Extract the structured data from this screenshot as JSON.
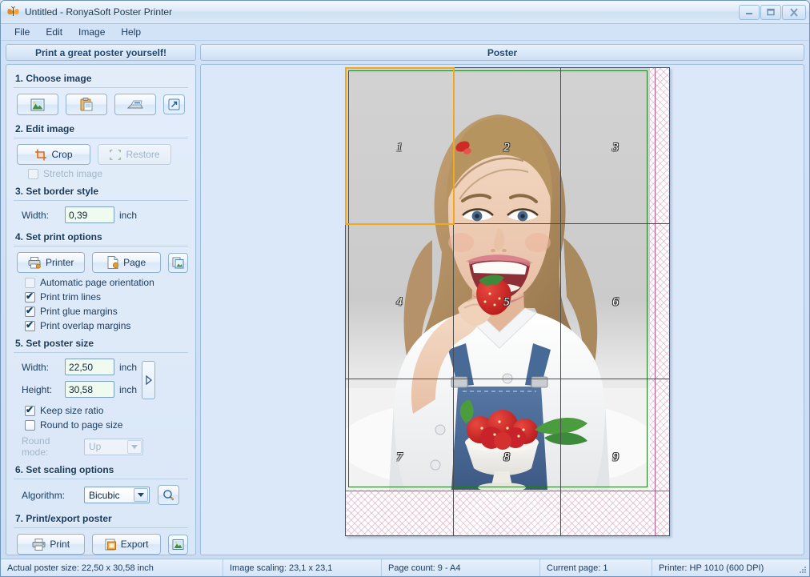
{
  "window": {
    "title": "Untitled - RonyaSoft Poster Printer",
    "icon": "butterfly-icon",
    "buttons": {
      "minimize": "–",
      "maximize": "❐",
      "close": "✕"
    }
  },
  "menu": {
    "items": [
      "File",
      "Edit",
      "Image",
      "Help"
    ]
  },
  "headers": {
    "left": "Print a great poster yourself!",
    "right": "Poster"
  },
  "sidebar": {
    "step1": {
      "title": "1. Choose image",
      "buttons": [
        {
          "name": "open-image-button",
          "icon": "picture-icon"
        },
        {
          "name": "paste-image-button",
          "icon": "clipboard-icon"
        },
        {
          "name": "scan-image-button",
          "icon": "scanner-icon"
        },
        {
          "name": "open-external-button",
          "icon": "external-link-icon"
        }
      ]
    },
    "step2": {
      "title": "2. Edit image",
      "crop_label": "Crop",
      "restore_label": "Restore",
      "stretch_label": "Stretch image",
      "stretch_checked": false,
      "stretch_enabled": false,
      "restore_enabled": false
    },
    "step3": {
      "title": "3. Set border style",
      "width_label": "Width:",
      "width_value": "0,39",
      "width_unit": "inch"
    },
    "step4": {
      "title": "4. Set print options",
      "printer_label": "Printer",
      "page_label": "Page",
      "extra_icon": "page-setup-icon",
      "options": [
        {
          "label": "Automatic page orientation",
          "checked": false
        },
        {
          "label": "Print trim lines",
          "checked": true
        },
        {
          "label": "Print glue margins",
          "checked": true
        },
        {
          "label": "Print overlap margins",
          "checked": true
        }
      ]
    },
    "step5": {
      "title": "5. Set poster size",
      "width_label": "Width:",
      "width_value": "22,50",
      "width_unit": "inch",
      "height_label": "Height:",
      "height_value": "30,58",
      "height_unit": "inch",
      "swap_icon": "swap-orientation-icon",
      "keep_ratio_label": "Keep size ratio",
      "keep_ratio_checked": true,
      "round_page_label": "Round to page size",
      "round_page_checked": false,
      "round_mode_label": "Round mode:",
      "round_mode_value": "Up",
      "round_mode_enabled": false
    },
    "step6": {
      "title": "6. Set scaling options",
      "algorithm_label": "Algorithm:",
      "algorithm_value": "Bicubic",
      "preview_icon": "magnifier-icon"
    },
    "step7": {
      "title": "7. Print/export poster",
      "print_label": "Print",
      "export_label": "Export",
      "extra_icon": "image-export-icon"
    }
  },
  "poster": {
    "columns": 3,
    "rows": 3,
    "page_numbers": [
      "1",
      "2",
      "3",
      "4",
      "5",
      "6",
      "7",
      "8",
      "9"
    ],
    "selected_page": "1",
    "colors": {
      "selection": "#f2a81c",
      "overlap_margin": "#1f7a1f",
      "trim_line": "#b8588c",
      "page_grid": "#4c4c4c",
      "panel_background": "#dbe8f9"
    }
  },
  "statusbar": {
    "cells": [
      "Actual poster size: 22,50 x 30,58 inch",
      "Image scaling: 23,1 x 23,1",
      "Page count: 9 - A4",
      "Current page: 1",
      "Printer: HP 1010 (600 DPI)"
    ]
  }
}
